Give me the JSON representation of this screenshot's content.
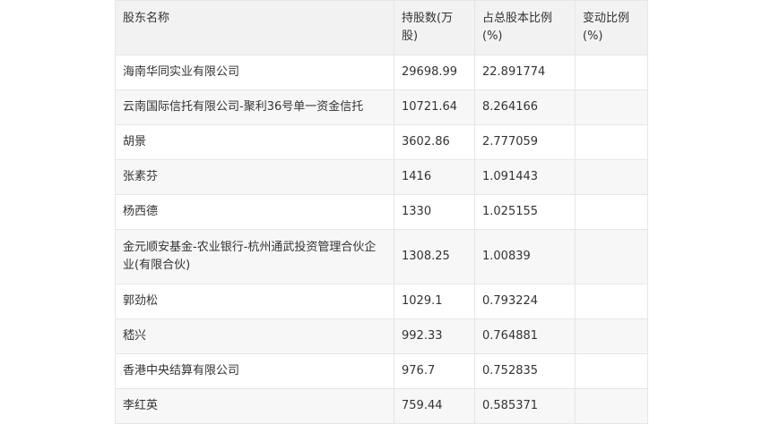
{
  "table": {
    "headers": [
      "股东名称",
      "持股数(万股)",
      "占总股本比例(%)",
      "变动比例(%)"
    ],
    "rows": [
      {
        "name": "海南华同实业有限公司",
        "shares": "29698.99",
        "ratio": "22.891774",
        "change": ""
      },
      {
        "name": "云南国际信托有限公司-聚利36号单一资金信托",
        "shares": "10721.64",
        "ratio": "8.264166",
        "change": ""
      },
      {
        "name": "胡景",
        "shares": "3602.86",
        "ratio": "2.777059",
        "change": ""
      },
      {
        "name": "张素芬",
        "shares": "1416",
        "ratio": "1.091443",
        "change": ""
      },
      {
        "name": "杨西德",
        "shares": "1330",
        "ratio": "1.025155",
        "change": ""
      },
      {
        "name": "金元顺安基金-农业银行-杭州通武投资管理合伙企业(有限合伙)",
        "shares": "1308.25",
        "ratio": "1.00839",
        "change": ""
      },
      {
        "name": "郭劲松",
        "shares": "1029.1",
        "ratio": "0.793224",
        "change": ""
      },
      {
        "name": "嵇兴",
        "shares": "992.33",
        "ratio": "0.764881",
        "change": ""
      },
      {
        "name": "香港中央结算有限公司",
        "shares": "976.7",
        "ratio": "0.752835",
        "change": ""
      },
      {
        "name": "李红英",
        "shares": "759.44",
        "ratio": "0.585371",
        "change": ""
      }
    ]
  }
}
